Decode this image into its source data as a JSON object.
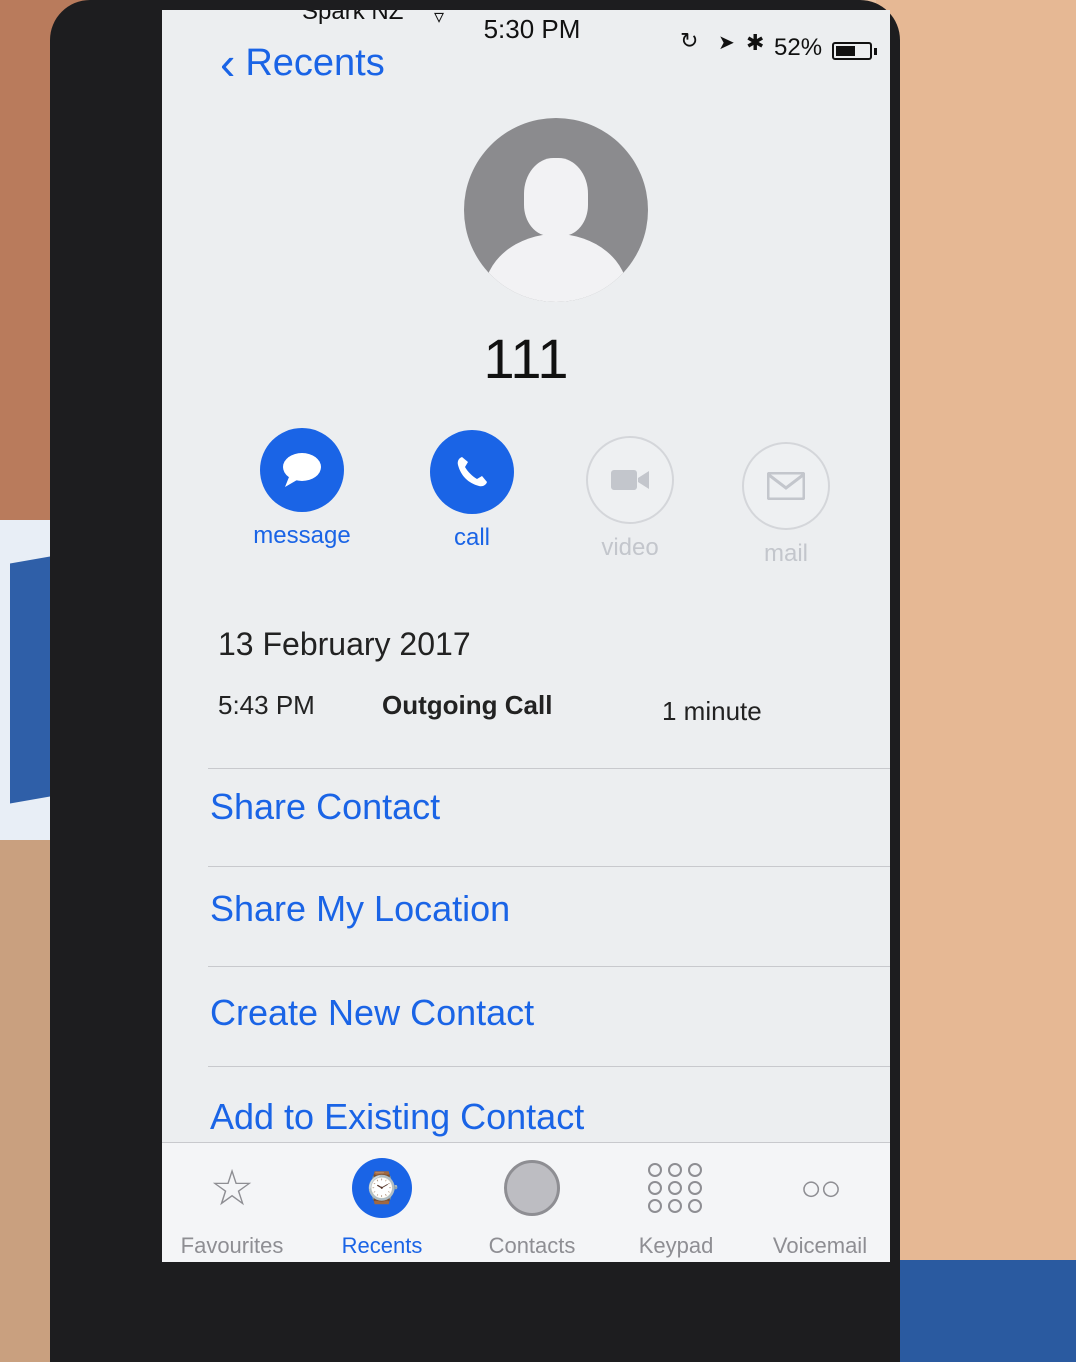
{
  "status_bar": {
    "carrier": "Spark NZ",
    "time": "5:30 PM",
    "battery": "52%"
  },
  "nav": {
    "back_label": "Recents"
  },
  "contact": {
    "name": "111"
  },
  "actions": [
    {
      "label": "message",
      "enabled": true,
      "icon": "message-bubble-icon"
    },
    {
      "label": "call",
      "enabled": true,
      "icon": "phone-icon"
    },
    {
      "label": "video",
      "enabled": false,
      "icon": "video-camera-icon"
    },
    {
      "label": "mail",
      "enabled": false,
      "icon": "envelope-icon"
    }
  ],
  "call_log": {
    "date": "13 February 2017",
    "entries": [
      {
        "time": "5:43 PM",
        "type": "Outgoing Call",
        "duration": "1 minute"
      }
    ]
  },
  "menu": {
    "share_contact": "Share Contact",
    "share_location": "Share My Location",
    "create_contact": "Create New Contact",
    "add_existing": "Add to Existing Contact"
  },
  "tabs": [
    {
      "label": "Favourites",
      "active": false,
      "icon": "star-icon"
    },
    {
      "label": "Recents",
      "active": true,
      "icon": "clock-icon"
    },
    {
      "label": "Contacts",
      "active": false,
      "icon": "person-icon"
    },
    {
      "label": "Keypad",
      "active": false,
      "icon": "keypad-icon"
    },
    {
      "label": "Voicemail",
      "active": false,
      "icon": "voicemail-icon"
    }
  ],
  "colors": {
    "accent": "#1a64e6",
    "inactive": "#8e8e93",
    "disabled": "#c3c6cc"
  }
}
